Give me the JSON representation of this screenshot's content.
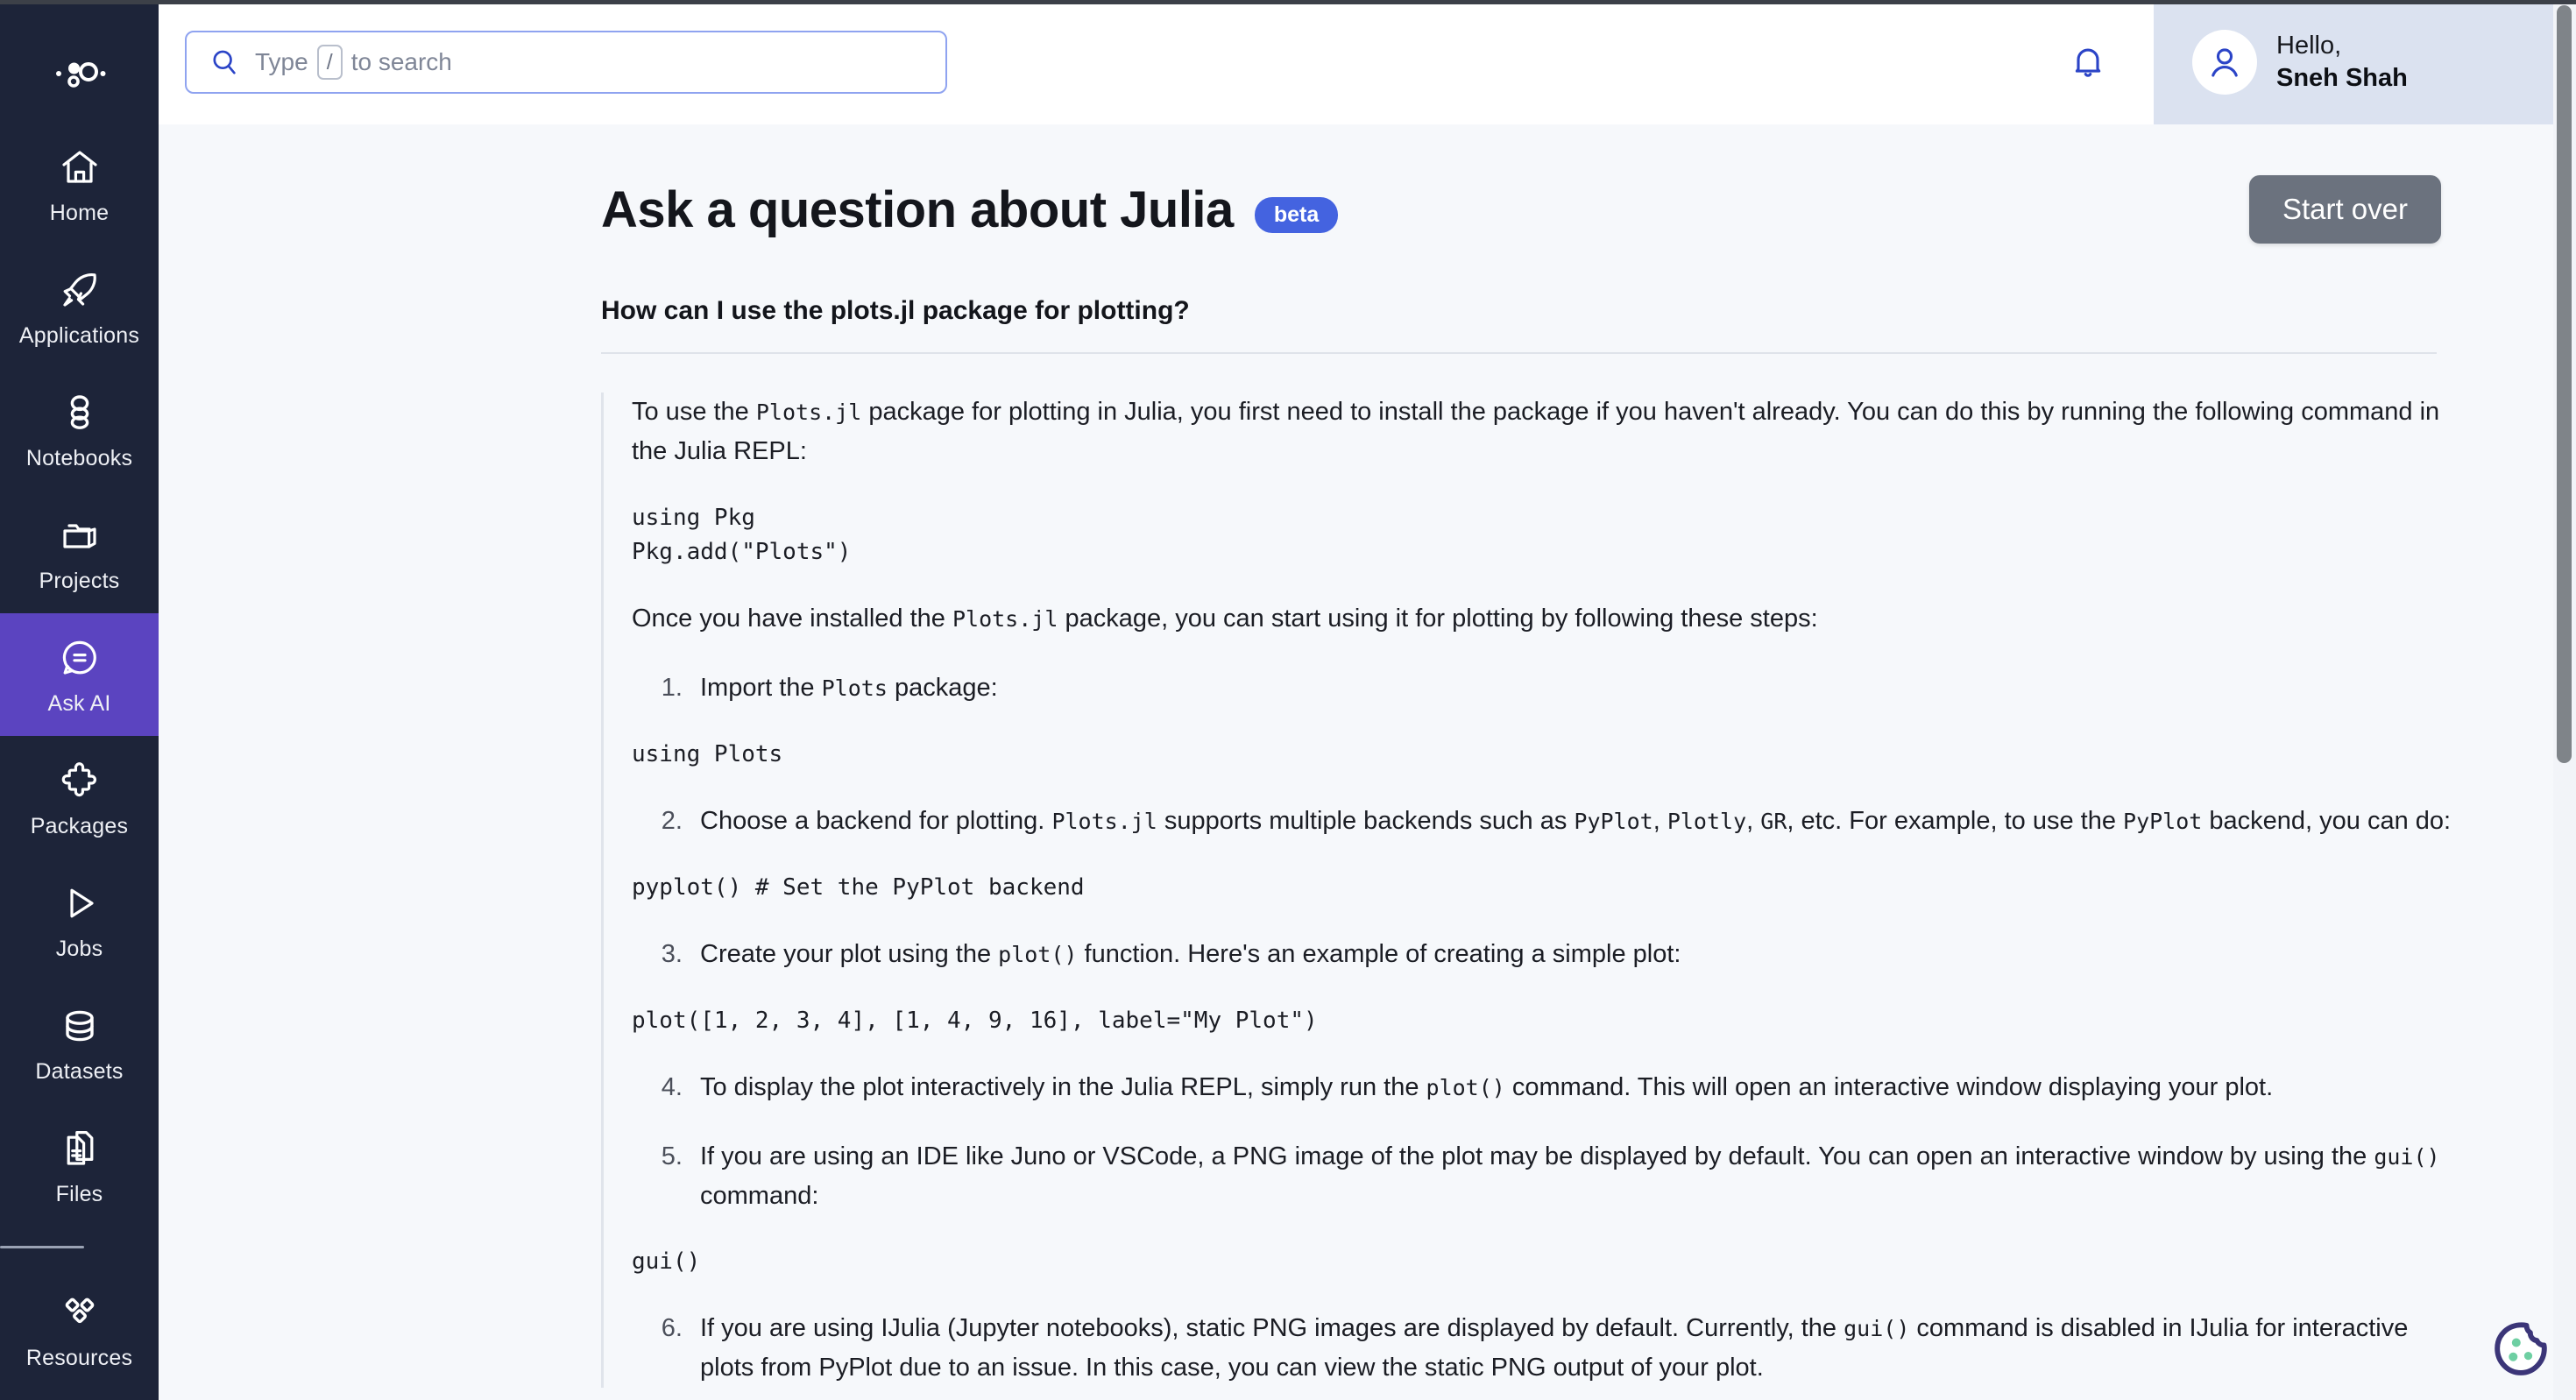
{
  "brand": {
    "logo_icon": "bubbles-logo-icon"
  },
  "sidebar": {
    "items": [
      {
        "label": "Home",
        "icon": "home-icon",
        "active": false
      },
      {
        "label": "Applications",
        "icon": "rocket-icon",
        "active": false
      },
      {
        "label": "Notebooks",
        "icon": "notebook-stack-icon",
        "active": false
      },
      {
        "label": "Projects",
        "icon": "folder-icon",
        "active": false
      },
      {
        "label": "Ask AI",
        "icon": "chat-bubble-icon",
        "active": true
      },
      {
        "label": "Packages",
        "icon": "puzzle-piece-icon",
        "active": false
      },
      {
        "label": "Jobs",
        "icon": "play-triangle-icon",
        "active": false
      },
      {
        "label": "Datasets",
        "icon": "database-icon",
        "active": false
      },
      {
        "label": "Files",
        "icon": "documents-icon",
        "active": false
      },
      {
        "label": "Resources",
        "icon": "diamond-grid-icon",
        "active": false
      }
    ],
    "active_color": "#5b44c0",
    "background_color": "#1d2439"
  },
  "topbar": {
    "search": {
      "icon": "search-icon",
      "placeholder_prefix": "Type",
      "placeholder_key": "/",
      "placeholder_suffix": "to search",
      "value": ""
    },
    "notifications_icon": "bell-icon",
    "user": {
      "avatar_icon": "person-avatar-icon",
      "greeting": "Hello,",
      "name": "Sneh Shah"
    }
  },
  "main": {
    "title": "Ask a question about Julia",
    "badge": "beta",
    "start_over_label": "Start over",
    "question": "How can I use the plots.jl package for plotting?",
    "answer": {
      "intro_1": "To use the ",
      "intro_code_1": "Plots.jl",
      "intro_2": " package for plotting in Julia, you first need to install the package if you haven't already. You can do this by running the following command in the Julia REPL:",
      "code_1": "using Pkg\nPkg.add(\"Plots\")",
      "para_2a": "Once you have installed the ",
      "para_2code": "Plots.jl",
      "para_2b": " package, you can start using it for plotting by following these steps:",
      "step1_a": "Import the ",
      "step1_code": "Plots",
      "step1_b": " package:",
      "code_2": "using Plots",
      "step2_a": "Choose a backend for plotting. ",
      "step2_code1": "Plots.jl",
      "step2_b": " supports multiple backends such as ",
      "step2_code2": "PyPlot",
      "step2_c": ", ",
      "step2_code3": "Plotly",
      "step2_d": ", ",
      "step2_code4": "GR",
      "step2_e": ", etc. For example, to use the ",
      "step2_code5": "PyPlot",
      "step2_f": " backend, you can do:",
      "code_3": "pyplot() # Set the PyPlot backend",
      "step3_a": "Create your plot using the ",
      "step3_code": "plot()",
      "step3_b": " function. Here's an example of creating a simple plot:",
      "code_4": "plot([1, 2, 3, 4], [1, 4, 9, 16], label=\"My Plot\")",
      "step4_a": "To display the plot interactively in the Julia REPL, simply run the ",
      "step4_code": "plot()",
      "step4_b": " command. This will open an interactive window displaying your plot.",
      "step5_a": "If you are using an IDE like Juno or VSCode, a PNG image of the plot may be displayed by default. You can open an interactive window by using the ",
      "step5_code": "gui()",
      "step5_b": " command:",
      "code_5": "gui()",
      "step6_a": "If you are using IJulia (Jupyter notebooks), static PNG images are displayed by default. Currently, the ",
      "step6_code": "gui()",
      "step6_b": " command is disabled in IJulia for interactive plots from PyPlot due to an issue. In this case, you can view the static PNG output of your plot."
    }
  },
  "widgets": {
    "cookie_icon": "cookie-icon"
  },
  "colors": {
    "accent_purple": "#5b44c0",
    "badge_blue": "#4463e0",
    "sidebar_dark": "#1d2439",
    "page_bg": "#f6f8fb",
    "button_gray": "#6b727e",
    "cookie_outline": "#3b3578",
    "cookie_dots": "#6ecfa2"
  }
}
